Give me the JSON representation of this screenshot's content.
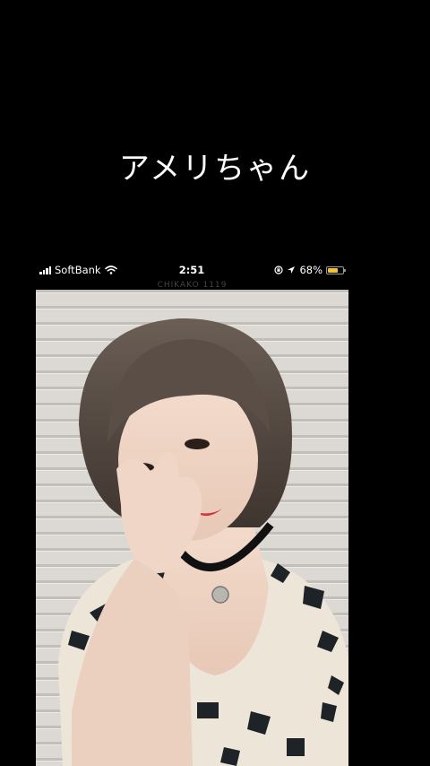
{
  "title": "アメリちゃん",
  "status_bar": {
    "carrier": "SoftBank",
    "time": "2:51",
    "battery_percent": "68%",
    "battery_level": 0.68,
    "battery_color": "#f2c230",
    "icons": [
      "signal-bars-icon",
      "wifi-icon",
      "screen-rotation-lock-icon",
      "location-arrow-icon",
      "battery-icon"
    ]
  },
  "photo": {
    "watermark": "CHIKAKO 1119"
  }
}
